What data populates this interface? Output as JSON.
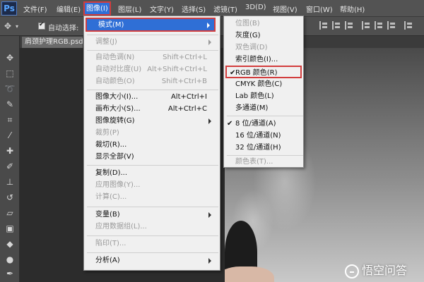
{
  "app": {
    "logo": "Ps"
  },
  "menubar": {
    "items": [
      "文件(F)",
      "编辑(E)",
      "图像(I)",
      "图层(L)",
      "文字(Y)",
      "选择(S)",
      "滤镜(T)",
      "3D(D)",
      "视图(V)",
      "窗口(W)",
      "帮助(H)"
    ]
  },
  "options_bar": {
    "auto_select_label": "自动选择:",
    "auto_select_checked": true
  },
  "document": {
    "tab_title": "肩颈护理RGB.psd"
  },
  "image_menu": {
    "mode": "模式(M)",
    "adjust": "调整(J)",
    "auto_tone": {
      "label": "自动色调(N)",
      "shortcut": "Shift+Ctrl+L"
    },
    "auto_contrast": {
      "label": "自动对比度(U)",
      "shortcut": "Alt+Shift+Ctrl+L"
    },
    "auto_color": {
      "label": "自动颜色(O)",
      "shortcut": "Shift+Ctrl+B"
    },
    "image_size": {
      "label": "图像大小(I)...",
      "shortcut": "Alt+Ctrl+I"
    },
    "canvas_size": {
      "label": "画布大小(S)...",
      "shortcut": "Alt+Ctrl+C"
    },
    "rotation": "图像旋转(G)",
    "crop": "裁剪(P)",
    "trim": "裁切(R)...",
    "reveal_all": "显示全部(V)",
    "duplicate": "复制(D)...",
    "apply_image": "应用图像(Y)...",
    "calculations": "计算(C)...",
    "variables": "变量(B)",
    "apply_data_set": "应用数据组(L)...",
    "trap": "陷印(T)...",
    "analysis": "分析(A)"
  },
  "mode_menu": {
    "bitmap": "位图(B)",
    "grayscale": "灰度(G)",
    "duotone": "双色调(D)",
    "indexed": "索引颜色(I)...",
    "rgb": "RGB 颜色(R)",
    "cmyk": "CMYK 颜色(C)",
    "lab": "Lab 颜色(L)",
    "multichannel": "多通道(M)",
    "bits8": "8 位/通道(A)",
    "bits16": "16 位/通道(N)",
    "bits32": "32 位/通道(H)",
    "color_table": "颜色表(T)...",
    "checked_items": [
      "RGB 颜色(R)",
      "8 位/通道(A)"
    ]
  },
  "watermark": {
    "text": "悟空问答"
  },
  "colors": {
    "highlight": "#2f6fd6",
    "annotation_red": "#d23d3d",
    "menu_bg": "#f0f0f0",
    "disabled_text": "#9a9a9a"
  }
}
